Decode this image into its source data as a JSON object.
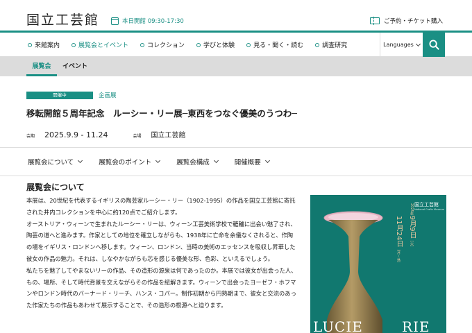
{
  "header": {
    "logo": "国立工芸館",
    "today_label": "本日開館 09:30-17:30",
    "ticket_label": "ご予約・チケット購入"
  },
  "nav": {
    "items": [
      {
        "label": "来館案内",
        "active": false
      },
      {
        "label": "展覧会とイベント",
        "active": true
      },
      {
        "label": "コレクション",
        "active": false
      },
      {
        "label": "学びと体験",
        "active": false
      },
      {
        "label": "見る・聞く・読む",
        "active": false
      },
      {
        "label": "調査研究",
        "active": false
      }
    ],
    "language_label": "Languages"
  },
  "subnav": {
    "tabs": [
      {
        "label": "展覧会",
        "active": true
      },
      {
        "label": "イベント",
        "active": false
      }
    ]
  },
  "exhibition": {
    "status_badge": "開催中",
    "category": "企画展",
    "title": "移転開館５周年記念　ルーシー・リー展─東西をつなぐ優美のうつわ─",
    "period_label": "会期",
    "period": "2025.9.9 - 11.24",
    "venue_label": "会場",
    "venue": "国立工芸館"
  },
  "section_tabs": [
    {
      "label": "展覧会について"
    },
    {
      "label": "展覧会のポイント"
    },
    {
      "label": "展覧会構成"
    },
    {
      "label": "開催概要"
    }
  ],
  "about": {
    "heading": "展覧会について",
    "paragraphs": [
      "本展は、20世紀を代表するイギリスの陶芸家ルーシー・リー（1902-1995）の作品を国立工芸館に寄託された井内コレクションを中心に約120点でご紹介します。",
      "オーストリア・ウィーンで生まれたルーシー・リーは、ウィーン工芸美術学校で轆轤に出会い魅了され、陶芸の道へと進みます。作家としての地位を確立しながらも、1938年に亡命を余儀なくされると、作陶の場をイギリス・ロンドンへ移します。ウィーン、ロンドン、当時の美術のエッセンスを吸収し昇華した彼女の作品の魅力。それは、しなやかながらも芯を感じる優美な形、色彩、といえるでしょう。",
      "私たちを魅了してやまないリーの作品、その造形の源泉は何であったのか。本展では彼女が出会った人、もの、場所、そして時代背景を交えながらその作品を紐解きます。ウィーンで出会ったヨーゼフ・ホフマンやロンドン時代のバーナード・リーチ、ハンス・コパー。制作初期から円熟期まで、彼女と交流のあった作家たちの作品もあわせて展示することで、その造形の根源へと迫ります。"
    ]
  },
  "poster": {
    "museum_name": "国立工芸館",
    "museum_name_en": "National Crafts Museum",
    "start_year": "2025年",
    "start_date": "9月9日",
    "start_day": "［火］",
    "end_date": "11月24日",
    "end_day": "［月・休］",
    "name_left": "LUCIE",
    "name_right": "RIE"
  },
  "colors": {
    "accent": "#1a8f84",
    "subnav_bg": "#dcdcdc",
    "poster_bg": "#11786f"
  }
}
